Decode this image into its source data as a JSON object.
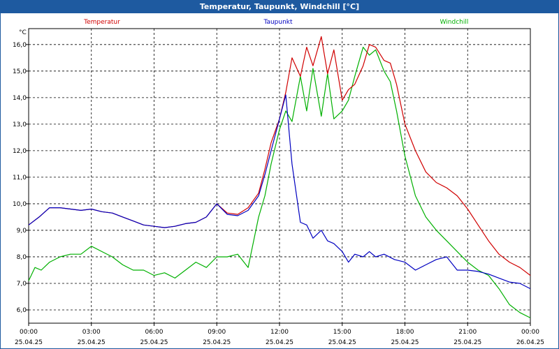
{
  "window": {
    "title": "Temperatur, Taupunkt, Windchill [°C]"
  },
  "colors": {
    "title_bar": "#1e5aa0",
    "temperatur": "#d00000",
    "taupunkt": "#0000c0",
    "windchill": "#00b000"
  },
  "chart_data": {
    "type": "line",
    "title": "Temperatur, Taupunkt, Windchill [°C]",
    "ylabel": "°C",
    "ylim": [
      5.5,
      16.6
    ],
    "xlim": [
      0,
      24
    ],
    "grid": true,
    "legend_placement": "top",
    "y_ticks": [
      "6,0",
      "7,0",
      "8,0",
      "9,0",
      "10,0",
      "11,0",
      "12,0",
      "13,0",
      "14,0",
      "15,0",
      "16,0"
    ],
    "x_ticks": [
      {
        "time": "00:00",
        "date": "25.04.25"
      },
      {
        "time": "03:00",
        "date": "25.04.25"
      },
      {
        "time": "06:00",
        "date": "25.04.25"
      },
      {
        "time": "09:00",
        "date": "25.04.25"
      },
      {
        "time": "12:00",
        "date": "25.04.25"
      },
      {
        "time": "15:00",
        "date": "25.04.25"
      },
      {
        "time": "18:00",
        "date": "25.04.25"
      },
      {
        "time": "21:00",
        "date": "25.04.25"
      },
      {
        "time": "00:00",
        "date": "26.04.25"
      }
    ],
    "series": [
      {
        "name": "Temperatur",
        "x": [
          0,
          0.5,
          1,
          1.5,
          2,
          2.5,
          3,
          3.5,
          4,
          4.5,
          5,
          5.5,
          6,
          6.5,
          7,
          7.5,
          8,
          8.5,
          9,
          9.5,
          10,
          10.5,
          11,
          11.3,
          11.6,
          12,
          12.3,
          12.6,
          13,
          13.3,
          13.6,
          14,
          14.3,
          14.6,
          15,
          15.3,
          15.6,
          16,
          16.3,
          16.6,
          17,
          17.3,
          17.6,
          18,
          18.5,
          19,
          19.5,
          20,
          20.5,
          21,
          21.5,
          22,
          22.5,
          23,
          23.5,
          24
        ],
        "y": [
          9.2,
          9.5,
          9.85,
          9.85,
          9.8,
          9.75,
          9.8,
          9.7,
          9.65,
          9.5,
          9.35,
          9.2,
          9.15,
          9.1,
          9.15,
          9.25,
          9.3,
          9.5,
          10.0,
          9.65,
          9.6,
          9.85,
          10.4,
          11.3,
          12.3,
          13.2,
          14.2,
          15.5,
          14.8,
          15.9,
          15.2,
          16.3,
          14.9,
          15.8,
          13.9,
          14.3,
          14.5,
          15.2,
          16.0,
          15.9,
          15.4,
          15.3,
          14.5,
          13.0,
          12.0,
          11.2,
          10.8,
          10.6,
          10.3,
          9.8,
          9.2,
          8.6,
          8.1,
          7.8,
          7.6,
          7.3
        ]
      },
      {
        "name": "Taupunkt",
        "x": [
          0,
          0.5,
          1,
          1.5,
          2,
          2.5,
          3,
          3.5,
          4,
          4.5,
          5,
          5.5,
          6,
          6.5,
          7,
          7.5,
          8,
          8.5,
          9,
          9.5,
          10,
          10.5,
          11,
          11.3,
          11.6,
          12,
          12.3,
          12.6,
          13,
          13.3,
          13.6,
          14,
          14.3,
          14.6,
          15,
          15.3,
          15.6,
          16,
          16.3,
          16.6,
          17,
          17.5,
          18,
          18.5,
          19,
          19.5,
          20,
          20.5,
          21,
          21.5,
          22,
          22.5,
          23,
          23.5,
          24
        ],
        "y": [
          9.2,
          9.5,
          9.85,
          9.85,
          9.8,
          9.75,
          9.8,
          9.7,
          9.65,
          9.5,
          9.35,
          9.2,
          9.15,
          9.1,
          9.15,
          9.25,
          9.3,
          9.5,
          10.0,
          9.6,
          9.55,
          9.75,
          10.3,
          11.1,
          12.0,
          13.2,
          14.1,
          11.5,
          9.3,
          9.2,
          8.7,
          9.0,
          8.6,
          8.5,
          8.2,
          7.8,
          8.1,
          8.0,
          8.2,
          8.0,
          8.1,
          7.9,
          7.8,
          7.5,
          7.7,
          7.9,
          8.0,
          7.5,
          7.5,
          7.45,
          7.35,
          7.2,
          7.05,
          7.0,
          6.8
        ]
      },
      {
        "name": "Windchill",
        "x": [
          0,
          0.3,
          0.6,
          1,
          1.5,
          2,
          2.5,
          3,
          3.5,
          4,
          4.5,
          5,
          5.5,
          6,
          6.5,
          7,
          7.5,
          8,
          8.5,
          9,
          9.5,
          10,
          10.5,
          11,
          11.3,
          11.6,
          12,
          12.3,
          12.6,
          13,
          13.3,
          13.6,
          14,
          14.3,
          14.6,
          15,
          15.3,
          15.6,
          16,
          16.3,
          16.6,
          17,
          17.3,
          17.6,
          18,
          18.5,
          19,
          19.5,
          20,
          20.5,
          21,
          21.5,
          22,
          22.5,
          23,
          23.5,
          24
        ],
        "y": [
          7.1,
          7.6,
          7.5,
          7.8,
          8.0,
          8.1,
          8.1,
          8.4,
          8.2,
          8.0,
          7.7,
          7.5,
          7.5,
          7.3,
          7.4,
          7.2,
          7.5,
          7.8,
          7.6,
          8.0,
          8.0,
          8.1,
          7.6,
          9.5,
          10.3,
          11.5,
          12.8,
          13.5,
          13.1,
          14.8,
          13.5,
          15.1,
          13.3,
          14.9,
          13.2,
          13.5,
          13.9,
          14.8,
          15.9,
          15.6,
          15.8,
          15.0,
          14.6,
          13.5,
          11.8,
          10.3,
          9.5,
          9.0,
          8.6,
          8.2,
          7.8,
          7.5,
          7.3,
          6.8,
          6.2,
          5.9,
          5.7
        ]
      }
    ]
  }
}
